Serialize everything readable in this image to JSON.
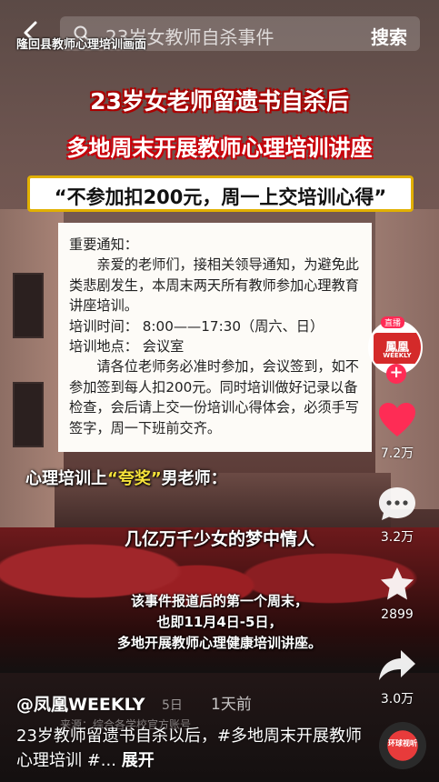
{
  "search": {
    "query": "23岁女教师自杀事件",
    "button_label": "搜索"
  },
  "video": {
    "watermark": "隆回县教师心理培训画面",
    "title_line1": "23岁女老师留遗书自杀后",
    "title_line2": "多地周末开展教师心理培训讲座",
    "quote": "“不参加扣200元，周一上交培训心得”",
    "notice": {
      "heading": "重要通知：",
      "para1": "亲爱的老师们，接相关领导通知，为避免此类悲剧发生，本周末两天所有教师参加心理教育讲座培训。",
      "time": "培训时间：  8:00——17:30（周六、日）",
      "location": "培训地点：  会议室",
      "para2": "请各位老师务必准时参加，会议签到，如不参加签到每人扣200元。同时培训做好记录以备检查，会后请上交一份培训心得体会，必须手写签字，周一下班前交齐。"
    },
    "caption_prefix": "心理培训上",
    "caption_highlight": "“夸奖”",
    "caption_suffix": "男老师：",
    "caption_quote": "几亿万千少女的梦中情人",
    "subtitle_line1": "该事件报道后的第一个周末，",
    "subtitle_line2": "也即11月4日-5日，",
    "subtitle_line3": "多地开展教师心理健康培训讲座。"
  },
  "rail": {
    "avatar_live": "直播",
    "avatar_name": "鳳凰",
    "avatar_sub": "WEEKLY",
    "follow": "+",
    "likes": "7.2万",
    "comments": "3.2万",
    "favorites": "2899",
    "shares": "3.0万"
  },
  "info": {
    "author": "@凤凰WEEKLY",
    "date_faded": "5日",
    "time_ago": "1天前",
    "source_faded": "来源：综合各学校官方账号",
    "desc": "23岁教师留遗书自杀以后，#多地周末开展教师心理培训 #...",
    "expand": "展开",
    "music_label": "环球视听"
  }
}
